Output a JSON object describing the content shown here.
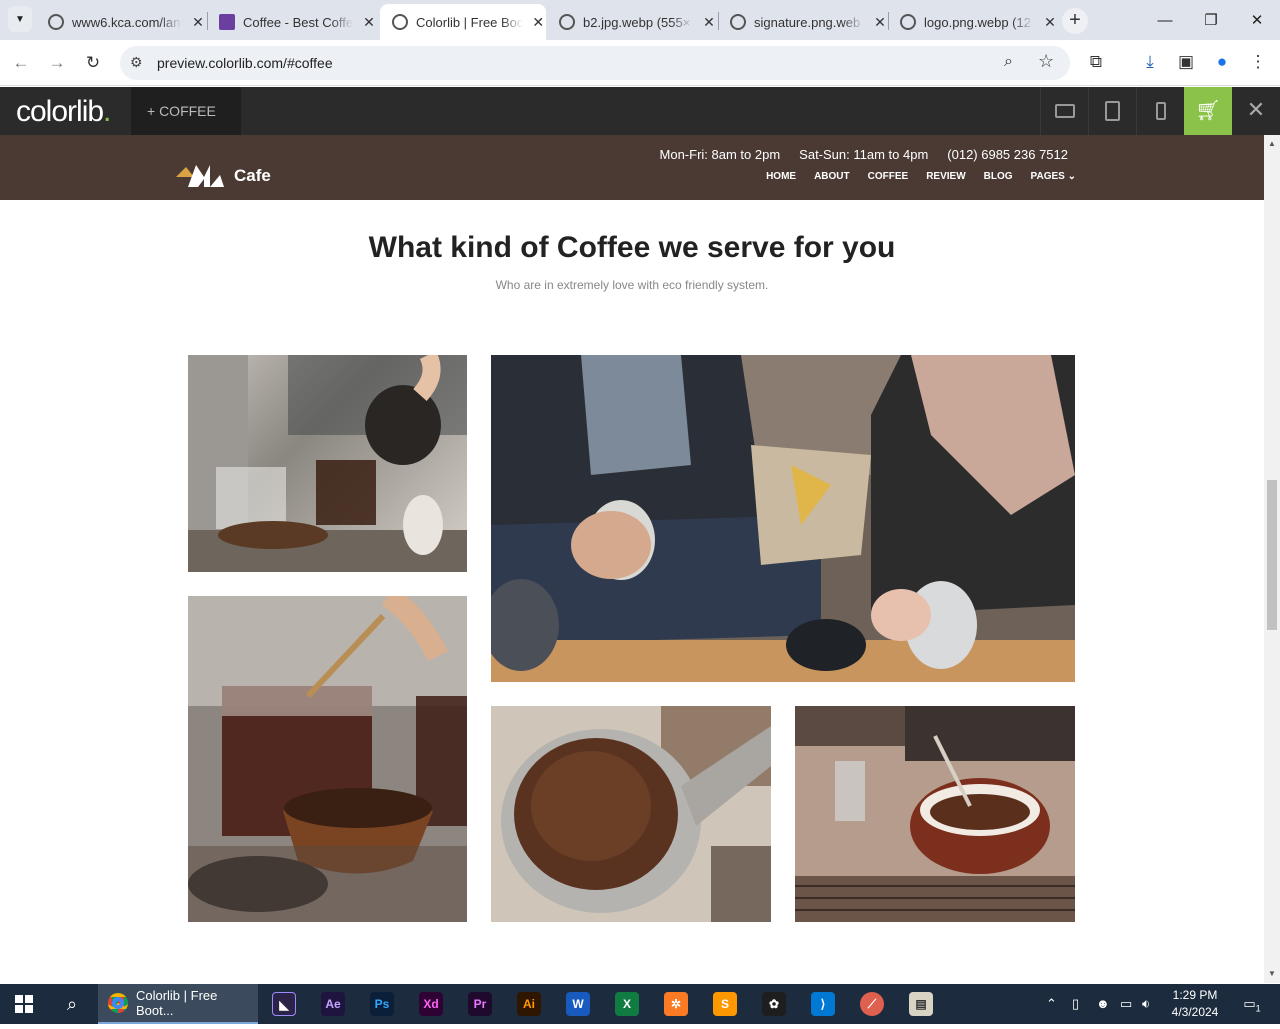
{
  "browser": {
    "tabs": [
      {
        "title": "www6.kca.com/lan",
        "active": false
      },
      {
        "title": "Coffee - Best Coffe",
        "active": false
      },
      {
        "title": "Colorlib | Free Boo",
        "active": true
      },
      {
        "title": "b2.jpg.webp (555×",
        "active": false
      },
      {
        "title": "signature.png.web",
        "active": false
      },
      {
        "title": "logo.png.webp (12",
        "active": false
      }
    ],
    "url": "preview.colorlib.com/#coffee"
  },
  "colorlib_bar": {
    "logo": "colorlib",
    "logo_dot": ".",
    "theme_label": "+ COFFEE"
  },
  "site": {
    "brand_name": "Cafe",
    "contact": {
      "hours_weekday": "Mon-Fri: 8am to 2pm",
      "hours_weekend": "Sat-Sun: 11am to 4pm",
      "phone": "(012) 6985 236 7512"
    },
    "menu": [
      "HOME",
      "ABOUT",
      "COFFEE",
      "REVIEW",
      "BLOG",
      "PAGES"
    ],
    "section_title": "What kind of Coffee we serve for you",
    "section_subtitle": "Who are in extremely love with eco friendly system."
  },
  "gallery": [
    {
      "name": "coffee-pouring-photo"
    },
    {
      "name": "couple-holding-cups-photo"
    },
    {
      "name": "coffee-beans-cup-photo"
    },
    {
      "name": "ground-coffee-portafilter-photo"
    },
    {
      "name": "espresso-machine-cup-photo"
    }
  ],
  "taskbar": {
    "active_app": "Colorlib | Free Boot...",
    "apps": [
      "Ae",
      "Ps",
      "Xd",
      "Pr",
      "Ai",
      "W",
      "X"
    ],
    "time": "1:29 PM",
    "date": "4/3/2024",
    "notification_count": "1"
  }
}
